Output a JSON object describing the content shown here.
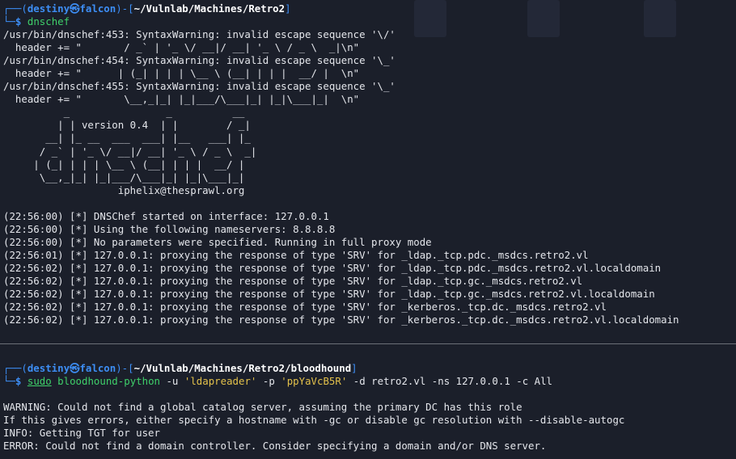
{
  "colors": {
    "background": "#1b1f2a",
    "prompt_blue": "#3d8ef5",
    "prompt_user": "#3d8ef5",
    "command_green": "#3fd06a",
    "string_yellow": "#e3c14b",
    "text": "#e4e6eb"
  },
  "session1": {
    "prompt": {
      "corner_top": "┌──(",
      "user": "destiny",
      "at": "㉿",
      "host": "falcon",
      "close": ")-[",
      "path": "~/Vulnlab/Machines/Retro2",
      "end": "]",
      "corner_bottom": "└─",
      "dollar": "$"
    },
    "command": "dnschef",
    "warnings": [
      "/usr/bin/dnschef:453: SyntaxWarning: invalid escape sequence '\\/'",
      "  header += \"       / _` | '_ \\/ __|/ __| '_ \\ / _ \\  _|\\n\"",
      "/usr/bin/dnschef:454: SyntaxWarning: invalid escape sequence '\\_'",
      "  header += \"      | (_| | | | \\__ \\ (__| | | |  __/ |  \\n\"",
      "/usr/bin/dnschef:455: SyntaxWarning: invalid escape sequence '\\_'",
      "  header += \"       \\__,_|_| |_|___/\\___|_| |_|\\___|_|  \\n\""
    ],
    "banner": [
      "          _                _          __  ",
      "         | | version 0.4  | |        / _| ",
      "       __| |_ __  ___  ___| |__   ___| |_ ",
      "      / _` | '_ \\/ __|/ __| '_ \\ / _ \\  _|",
      "     | (_| | | | \\__ \\ (__| | | |  __/ |  ",
      "      \\__,_|_| |_|___/\\___|_| |_|\\___|_|  ",
      "                   iphelix@thesprawl.org  "
    ],
    "log": [
      "(22:56:00) [*] DNSChef started on interface: 127.0.0.1",
      "(22:56:00) [*] Using the following nameservers: 8.8.8.8",
      "(22:56:00) [*] No parameters were specified. Running in full proxy mode",
      "(22:56:01) [*] 127.0.0.1: proxying the response of type 'SRV' for _ldap._tcp.pdc._msdcs.retro2.vl",
      "(22:56:02) [*] 127.0.0.1: proxying the response of type 'SRV' for _ldap._tcp.pdc._msdcs.retro2.vl.localdomain",
      "(22:56:02) [*] 127.0.0.1: proxying the response of type 'SRV' for _ldap._tcp.gc._msdcs.retro2.vl",
      "(22:56:02) [*] 127.0.0.1: proxying the response of type 'SRV' for _ldap._tcp.gc._msdcs.retro2.vl.localdomain",
      "(22:56:02) [*] 127.0.0.1: proxying the response of type 'SRV' for _kerberos._tcp.dc._msdcs.retro2.vl",
      "(22:56:02) [*] 127.0.0.1: proxying the response of type 'SRV' for _kerberos._tcp.dc._msdcs.retro2.vl.localdomain"
    ]
  },
  "session2": {
    "prompt": {
      "corner_top": "┌──(",
      "user": "destiny",
      "at": "㉿",
      "host": "falcon",
      "close": ")-[",
      "path": "~/Vulnlab/Machines/Retro2/bloodhound",
      "end": "]",
      "corner_bottom": "└─",
      "dollar": "$"
    },
    "command": {
      "sudo": "sudo",
      "tool": "bloodhound-python",
      "flag_u": "-u",
      "user": "'ldapreader'",
      "flag_p": "-p",
      "password": "'ppYaVcB5R'",
      "flag_d": "-d",
      "domain": "retro2.vl",
      "flag_ns": "-ns",
      "ns": "127.0.0.1",
      "flag_c": "-c",
      "collect": "All"
    },
    "output": [
      "WARNING: Could not find a global catalog server, assuming the primary DC has this role",
      "If this gives errors, either specify a hostname with -gc or disable gc resolution with --disable-autogc",
      "INFO: Getting TGT for user",
      "ERROR: Could not find a domain controller. Consider specifying a domain and/or DNS server."
    ]
  }
}
